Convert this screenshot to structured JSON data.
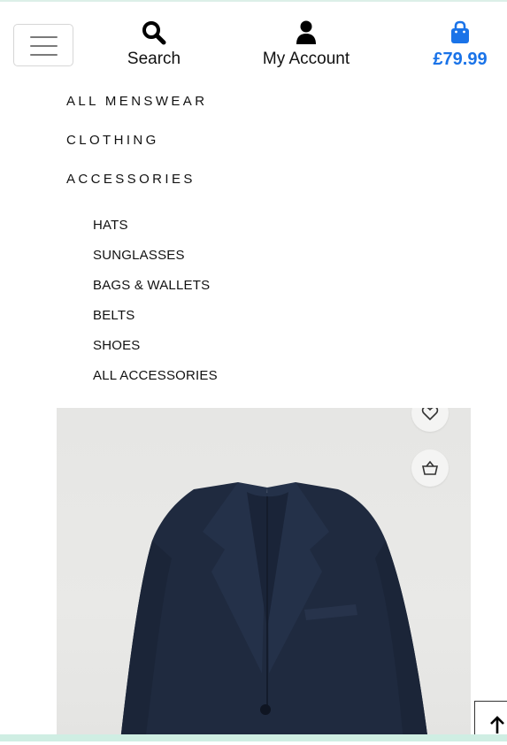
{
  "header": {
    "search_label": "Search",
    "account_label": "My Account",
    "bag_total": "£79.99"
  },
  "menu": {
    "categories": [
      "ALL MENSWEAR",
      "CLOTHING",
      "ACCESSORIES"
    ],
    "accessories": [
      "HATS",
      "SUNGLASSES",
      "BAGS & WALLETS",
      "BELTS",
      "SHOES",
      "ALL ACCESSORIES"
    ]
  },
  "icons": {
    "menu": "hamburger-icon",
    "search": "search-icon",
    "account": "user-icon",
    "bag": "shopping-bag-icon",
    "wishlist": "heart-icon",
    "add_to_bag": "basket-icon",
    "back_to_top": "arrow-up-icon"
  },
  "colors": {
    "accent": "#1a73e8",
    "jacket": "#1f2a3f",
    "bottom_rule": "#cfeee3"
  }
}
